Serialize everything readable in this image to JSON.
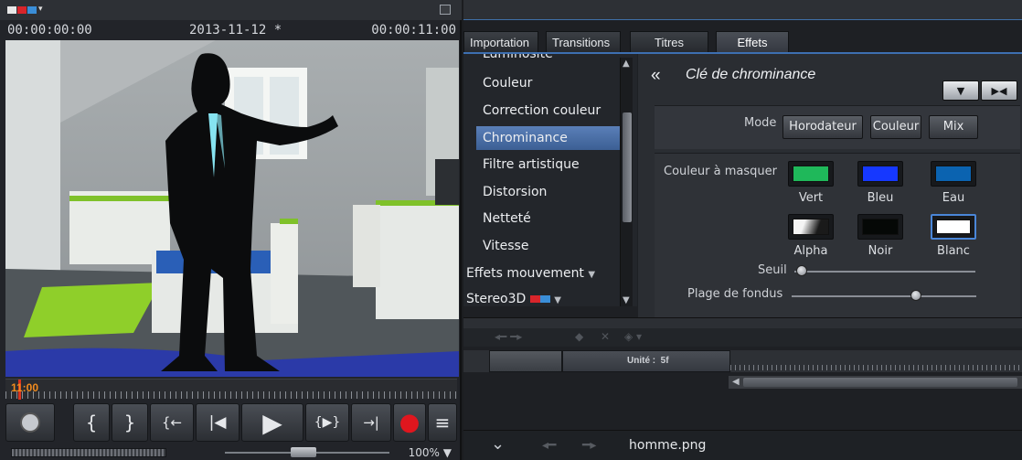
{
  "monitor": {
    "timecode_start": "00:00:00:00",
    "project_date": "2013-11-12 *",
    "timecode_end": "00:00:11:00",
    "ruler_position": "11:00",
    "zoom": "100%",
    "transport_buttons": [
      "{",
      "}",
      "{←",
      "|◀",
      "▶",
      "{▶}",
      "→|",
      "●",
      "≡"
    ]
  },
  "tabs": [
    {
      "label": "Importation"
    },
    {
      "label": "Transitions"
    },
    {
      "label": "Titres"
    },
    {
      "label": "Effets",
      "active": true
    }
  ],
  "effects_list": {
    "items": [
      {
        "label": "Luminosité"
      },
      {
        "label": "Couleur"
      },
      {
        "label": "Correction couleur"
      },
      {
        "label": "Chrominance",
        "selected": true
      },
      {
        "label": "Filtre artistique"
      },
      {
        "label": "Distorsion"
      },
      {
        "label": "Netteté"
      },
      {
        "label": "Vitesse"
      },
      {
        "label": "Effets mouvement",
        "category": true
      },
      {
        "label": "Stereo3D",
        "category": true
      }
    ]
  },
  "chroma_panel": {
    "back_label": "«",
    "title": "Clé de chrominance",
    "mode_label": "Mode",
    "mode_buttons": [
      "Horodateur",
      "Couleur",
      "Mix"
    ],
    "color_label": "Couleur à masquer",
    "swatches": [
      {
        "label": "Vert",
        "color": "#1fb85a"
      },
      {
        "label": "Bleu",
        "color": "#1638ff"
      },
      {
        "label": "Eau",
        "color": "#0b63b0"
      },
      {
        "label": "Alpha",
        "color": "gradient-alpha"
      },
      {
        "label": "Noir",
        "color": "#050806"
      },
      {
        "label": "Blanc",
        "color": "#ffffff",
        "selected": true
      }
    ],
    "seuil_label": "Seuil",
    "seuil_value": 0.0,
    "plage_label": "Plage de fondus",
    "plage_value": 0.78
  },
  "timeline": {
    "unit_label": "Unité :",
    "unit_value": "5f"
  },
  "bottom": {
    "filename": "homme.png"
  },
  "colors": {
    "accent": "#3d6fb1",
    "record": "#e0161e"
  }
}
